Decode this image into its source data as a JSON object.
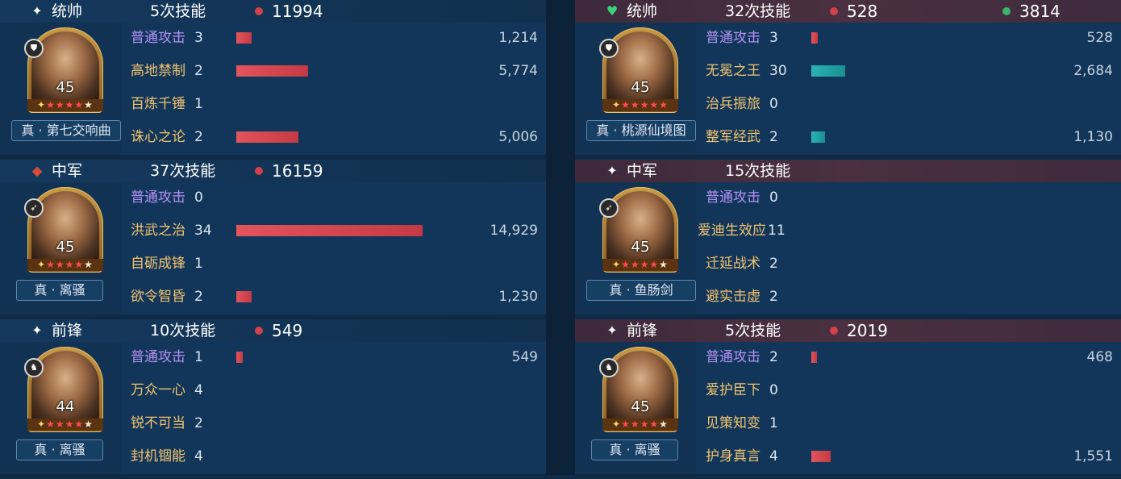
{
  "colors": {
    "red_dot": "#d2404c",
    "green_dot": "#3bb36a",
    "bar_red": "#d6464f",
    "bar_teal": "#25a7a8"
  },
  "left": {
    "blocks": [
      {
        "role": "统帅",
        "role_icon": "sparkle-icon",
        "casts": "5次技能",
        "damage_total": "11994",
        "heal_total": "",
        "level": "45",
        "stars": 4,
        "badge_icon": "infantry-icon",
        "treasure": "真 · 第七交响曲",
        "skills": [
          {
            "name": "普通攻击",
            "count": "3",
            "value": "1,214",
            "bar": 1214
          },
          {
            "name": "高地禁制",
            "count": "2",
            "value": "5,774",
            "bar": 5774
          },
          {
            "name": "百炼千锤",
            "count": "1",
            "value": "",
            "bar": 0
          },
          {
            "name": "诛心之论",
            "count": "2",
            "value": "5,006",
            "bar": 5006
          }
        ]
      },
      {
        "role": "中军",
        "role_icon": "red-diamond-icon",
        "casts": "37次技能",
        "damage_total": "16159",
        "heal_total": "",
        "level": "45",
        "stars": 4,
        "badge_icon": "archer-icon",
        "treasure": "真 · 离骚",
        "skills": [
          {
            "name": "普通攻击",
            "count": "0",
            "value": "",
            "bar": 0
          },
          {
            "name": "洪武之治",
            "count": "34",
            "value": "14,929",
            "bar": 14929
          },
          {
            "name": "自砺成锋",
            "count": "1",
            "value": "",
            "bar": 0
          },
          {
            "name": "欲令智昏",
            "count": "2",
            "value": "1,230",
            "bar": 1230
          }
        ]
      },
      {
        "role": "前锋",
        "role_icon": "sparkle-icon",
        "casts": "10次技能",
        "damage_total": "549",
        "heal_total": "",
        "level": "44",
        "stars": 4,
        "badge_icon": "cavalry-icon",
        "treasure": "真 · 离骚",
        "skills": [
          {
            "name": "普通攻击",
            "count": "1",
            "value": "549",
            "bar": 549
          },
          {
            "name": "万众一心",
            "count": "4",
            "value": "",
            "bar": 0
          },
          {
            "name": "锐不可当",
            "count": "2",
            "value": "",
            "bar": 0
          },
          {
            "name": "封机锢能",
            "count": "4",
            "value": "",
            "bar": 0
          }
        ]
      }
    ]
  },
  "right": {
    "blocks": [
      {
        "role": "统帅",
        "role_icon": "green-heart-icon",
        "casts": "32次技能",
        "damage_total": "528",
        "heal_total": "3814",
        "level": "45",
        "stars": 5,
        "badge_icon": "infantry-icon",
        "treasure": "真 · 桃源仙境图",
        "skills": [
          {
            "name": "普通攻击",
            "count": "3",
            "value": "528",
            "bar": 528,
            "color": "red"
          },
          {
            "name": "无冕之王",
            "count": "30",
            "value": "2,684",
            "bar": 2684,
            "color": "teal"
          },
          {
            "name": "治兵振旅",
            "count": "0",
            "value": "",
            "bar": 0,
            "color": "red"
          },
          {
            "name": "整军经武",
            "count": "2",
            "value": "1,130",
            "bar": 1130,
            "color": "teal"
          }
        ]
      },
      {
        "role": "中军",
        "role_icon": "sparkle-icon",
        "casts": "15次技能",
        "damage_total": "",
        "heal_total": "",
        "level": "45",
        "stars": 4,
        "badge_icon": "archer-icon",
        "treasure": "真 · 鱼肠剑",
        "skills": [
          {
            "name": "普通攻击",
            "count": "0",
            "value": "",
            "bar": 0,
            "color": "red"
          },
          {
            "name": "爱迪生效应",
            "count": "11",
            "value": "",
            "bar": 0,
            "color": "red"
          },
          {
            "name": "迁延战术",
            "count": "2",
            "value": "",
            "bar": 0,
            "color": "red"
          },
          {
            "name": "避实击虚",
            "count": "2",
            "value": "",
            "bar": 0,
            "color": "red"
          }
        ]
      },
      {
        "role": "前锋",
        "role_icon": "sparkle-icon",
        "casts": "5次技能",
        "damage_total": "2019",
        "heal_total": "",
        "level": "45",
        "stars": 4,
        "badge_icon": "cavalry-icon",
        "treasure": "真 · 离骚",
        "skills": [
          {
            "name": "普通攻击",
            "count": "2",
            "value": "468",
            "bar": 468,
            "color": "red"
          },
          {
            "name": "爱护臣下",
            "count": "0",
            "value": "",
            "bar": 0,
            "color": "red"
          },
          {
            "name": "见策知变",
            "count": "1",
            "value": "",
            "bar": 0,
            "color": "red"
          },
          {
            "name": "护身真言",
            "count": "4",
            "value": "1,551",
            "bar": 1551,
            "color": "red"
          }
        ]
      }
    ]
  }
}
